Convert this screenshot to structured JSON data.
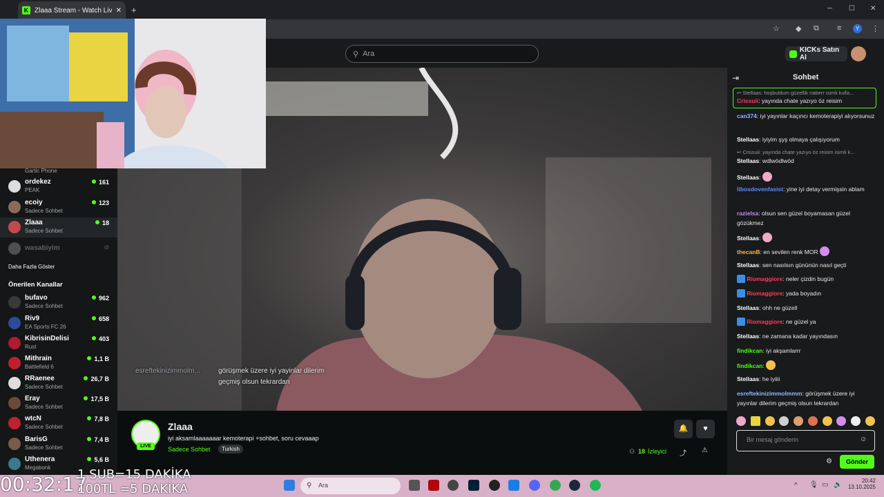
{
  "browser": {
    "tab_title": "Zlaaa Stream - Watch Live o",
    "new_tab": "+",
    "window_min": "─",
    "window_max": "☐",
    "window_close": "✕"
  },
  "header": {
    "search_placeholder": "Ara",
    "buy_kicks": "KICKs Satın Al"
  },
  "sidebar": {
    "top_partial_category": "Gartic Phone",
    "followed": [
      {
        "name": "ordekez",
        "category": "PEAK",
        "viewers": "161"
      },
      {
        "name": "ecoiy",
        "category": "Sadece Sohbet",
        "viewers": "123"
      },
      {
        "name": "Zlaaa",
        "category": "Sadece Sohbet",
        "viewers": "18"
      },
      {
        "name": "wasabiyim",
        "category": "",
        "viewers": ""
      }
    ],
    "show_more": "Daha Fazla Göster",
    "recommended_title": "Önerilen Kanallar",
    "recommended": [
      {
        "name": "bufavo",
        "category": "Sadece Sohbet",
        "viewers": "962"
      },
      {
        "name": "Riv9",
        "category": "EA Sports FC 26",
        "viewers": "658"
      },
      {
        "name": "KibrisinDelisi",
        "category": "Rust",
        "viewers": "403"
      },
      {
        "name": "Mithrain",
        "category": "Battlefield 6",
        "viewers": "1,1 B"
      },
      {
        "name": "RRaenee",
        "category": "Sadece Sohbet",
        "viewers": "26,7 B"
      },
      {
        "name": "Eray",
        "category": "Sadece Sohbet",
        "viewers": "17,5 B"
      },
      {
        "name": "wtcN",
        "category": "Sadece Sohbet",
        "viewers": "7,8 B"
      },
      {
        "name": "BarisG",
        "category": "Sadece Sohbet",
        "viewers": "7,4 B"
      },
      {
        "name": "Uthenera",
        "category": "Megabonk",
        "viewers": "5,6 B"
      }
    ]
  },
  "video": {
    "caption_user": "esreftekinizimmolm...",
    "caption_line1": "görüşmek üzere iyi yayinlar dilerim",
    "caption_line2": "geçmiş olsun tekrardan"
  },
  "stream": {
    "channel": "Zlaaa",
    "live_badge": "LIVE",
    "title": "iyi aksamlaaaaaaar kemoterapi +sohbet, soru cevaaap",
    "category": "Sadece Sohbet",
    "language_tag": "Turkish",
    "viewer_count": "18",
    "viewer_label": "İzleyici"
  },
  "chat": {
    "title": "Sohbet",
    "reply_context": "↩ Stellaas: hoşbuldum güzellik naberr isimli kulla...",
    "reply_user": "Crissuii",
    "reply_text": ": yayında chate yazıyo öz reisim",
    "messages": [
      {
        "user": "can374",
        "color": "#8fb8ff",
        "text": ": iyi yayınlar kaçıncı kemoterapiyi alıyorsunuz"
      },
      {
        "user": "Stellaas",
        "color": "#ffffff",
        "text": ": iyiyim şyş olmaya çalışıyorum"
      },
      {
        "reply": "↩ Crissuii: yayında chate yazıyo öz reisim isimli k..."
      },
      {
        "user": "Stellaas",
        "color": "#ffffff",
        "text": ": wdlwödlwöd"
      },
      {
        "user": "Stellaas",
        "color": "#ffffff",
        "text": ":"
      },
      {
        "user": "libosdovenfasist",
        "color": "#5e8cff",
        "text": ": yine iyi detay vermişsin ablam"
      },
      {
        "user": "razielsa",
        "color": "#c08cff",
        "text": ": olsun sen güzel boyamasan güzel gözükmez"
      },
      {
        "user": "Stellaas",
        "color": "#ffffff",
        "text": ":"
      },
      {
        "user": "thecanB",
        "color": "#ffb347",
        "text": ": en sevilen renk MOR"
      },
      {
        "user": "Stellaas",
        "color": "#ffffff",
        "text": ": sen nasılsın gününün nasıl geçti"
      },
      {
        "user": "Riomaggiore",
        "color": "#ff3b5c",
        "text": ": neler çizdin bugün"
      },
      {
        "user": "Riomaggiore",
        "color": "#ff3b5c",
        "text": ": yada boyadın"
      },
      {
        "user": "Stellaas",
        "color": "#ffffff",
        "text": ": ohh ne güzell"
      },
      {
        "user": "Riomaggiore",
        "color": "#ff3b5c",
        "text": ": ne güzel ya"
      },
      {
        "user": "Stellaas",
        "color": "#ffffff",
        "text": ": ne zamana kadar yayındasın"
      },
      {
        "user": "findikcan",
        "color": "#53fc18",
        "text": ": iyi akşamlarrr"
      },
      {
        "user": "findikcan",
        "color": "#53fc18",
        "text": ":"
      },
      {
        "user": "Stellaas",
        "color": "#ffffff",
        "text": ": he iyiiii"
      },
      {
        "user": "esreftekinizimmolmmm",
        "color": "#8fb8ff",
        "text": ": görüşmek üzere iyi yayınlar dilerim geçmiş olsun tekrardan"
      }
    ],
    "input_placeholder": "Bir mesaj gönderin",
    "send_label": "Gönder"
  },
  "overlay": {
    "timer": "00:32:17",
    "line1": "1 SUB=15 DAKİKA",
    "line2": "100TL =5 DAKİKA"
  },
  "taskbar": {
    "search_placeholder": "Ara",
    "time": "20:42",
    "date": "13.10.2025"
  }
}
